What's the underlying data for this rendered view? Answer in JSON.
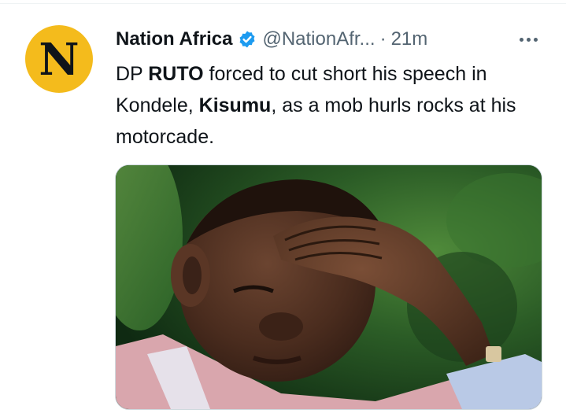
{
  "tweet": {
    "avatar_letter": "N",
    "display_name": "Nation Africa",
    "handle": "@NationAfr...",
    "separator": "·",
    "timestamp": "21m",
    "body": {
      "t1": "DP ",
      "t2": "RUTO",
      "t3": " forced to cut short his speech in Kondele, ",
      "t4": "Kisumu",
      "t5": ", as a mob hurls rocks at his motorcade."
    },
    "media": {
      "description_icon": "photo"
    }
  },
  "colors": {
    "avatar_bg": "#f4bb1c",
    "verified": "#1d9bf0",
    "muted_text": "#536471",
    "primary_text": "#0f1419"
  }
}
